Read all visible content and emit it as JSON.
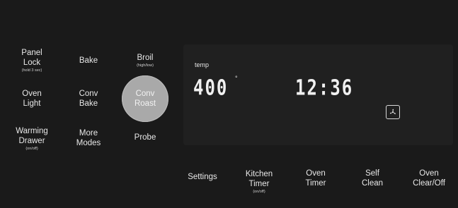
{
  "left_panel": {
    "panel_lock": {
      "line1": "Panel",
      "line2": "Lock",
      "sub": "(hold 3 sec)"
    },
    "bake": {
      "line1": "Bake"
    },
    "broil": {
      "line1": "Broil",
      "sub": "(high/low)"
    },
    "oven_light": {
      "line1": "Oven",
      "line2": "Light"
    },
    "conv_bake": {
      "line1": "Conv",
      "line2": "Bake"
    },
    "conv_roast": {
      "line1": "Conv",
      "line2": "Roast"
    },
    "warming_drawer": {
      "line1": "Warming",
      "line2": "Drawer",
      "sub": "(on/off)"
    },
    "more_modes": {
      "line1": "More",
      "line2": "Modes"
    },
    "probe": {
      "line1": "Probe"
    }
  },
  "display": {
    "temp_label": "temp",
    "temperature": "400",
    "degree_symbol": "°",
    "clock": "12:36",
    "mode_icon": "convection-fan-icon"
  },
  "bottom_row": {
    "settings": {
      "line1": "Settings"
    },
    "kitchen_timer": {
      "line1": "Kitchen",
      "line2": "Timer",
      "sub": "(on/off)"
    },
    "oven_timer": {
      "line1": "Oven",
      "line2": "Timer"
    },
    "self_clean": {
      "line1": "Self",
      "line2": "Clean"
    },
    "oven_clear_off": {
      "line1": "Oven",
      "line2": "Clear/Off"
    }
  },
  "colors": {
    "background": "#1a1a1a",
    "display_bg": "#202020",
    "highlight": "#a9a9a9",
    "text": "#e6e6e6"
  }
}
